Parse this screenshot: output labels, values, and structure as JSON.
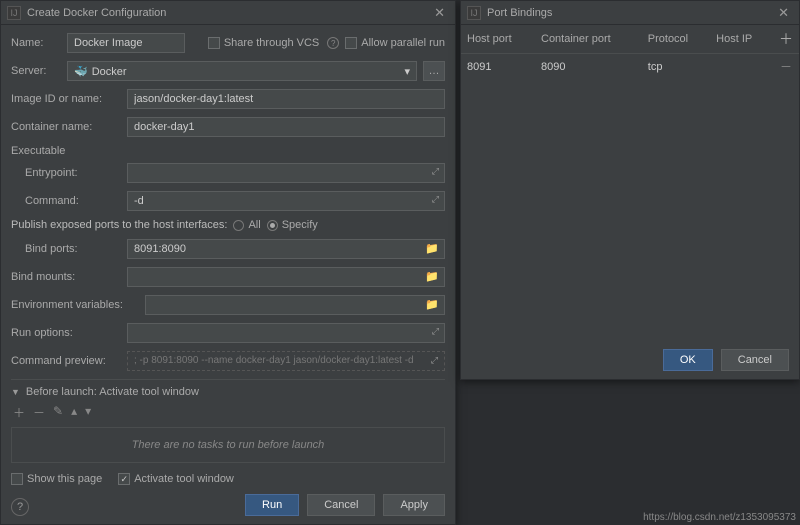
{
  "left_window": {
    "title": "Create Docker Configuration",
    "name_label": "Name:",
    "name_value": "Docker Image",
    "share_vcs": "Share through VCS",
    "allow_parallel": "Allow parallel run",
    "server_label": "Server:",
    "server_value": "Docker",
    "image_id_label": "Image ID or name:",
    "image_id_value": "jason/docker-day1:latest",
    "container_label": "Container name:",
    "container_value": "docker-day1",
    "executable_section": "Executable",
    "entrypoint_label": "Entrypoint:",
    "entrypoint_value": "",
    "command_label": "Command:",
    "command_value": "-d",
    "publish_label": "Publish exposed ports to the host interfaces:",
    "radio_all": "All",
    "radio_specify": "Specify",
    "bind_ports_label": "Bind ports:",
    "bind_ports_value": "8091:8090",
    "bind_mounts_label": "Bind mounts:",
    "env_label": "Environment variables:",
    "run_options_label": "Run options:",
    "preview_label": "Command preview:",
    "preview_value": "; -p 8091:8090 --name docker-day1 jason/docker-day1:latest -d",
    "before_launch_title": "Before launch: Activate tool window",
    "bl_placeholder": "There are no tasks to run before launch",
    "show_page": "Show this page",
    "activate_tool": "Activate tool window",
    "btn_run": "Run",
    "btn_cancel": "Cancel",
    "btn_apply": "Apply"
  },
  "right_window": {
    "title": "Port Bindings",
    "columns": {
      "host_port": "Host port",
      "container_port": "Container port",
      "protocol": "Protocol",
      "host_ip": "Host IP"
    },
    "rows": [
      {
        "host_port": "8091",
        "container_port": "8090",
        "protocol": "tcp",
        "host_ip": ""
      }
    ],
    "btn_ok": "OK",
    "btn_cancel": "Cancel"
  },
  "watermark": "https://blog.csdn.net/z1353095373"
}
